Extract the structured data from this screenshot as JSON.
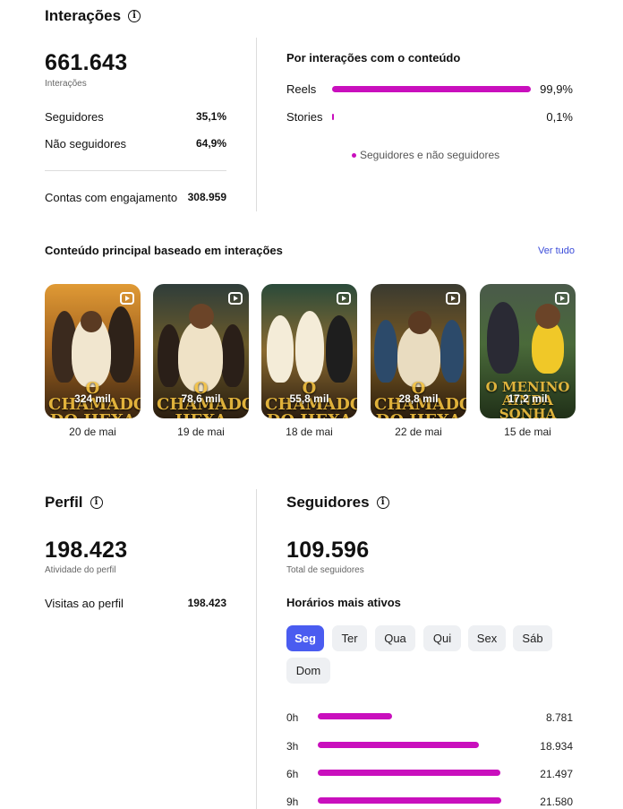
{
  "interactions": {
    "title": "Interações",
    "total": "661.643",
    "total_label": "Interações",
    "followers_label": "Seguidores",
    "followers_pct": "35,1%",
    "non_followers_label": "Não seguidores",
    "non_followers_pct": "64,9%",
    "engaged_label": "Contas com engajamento",
    "engaged_value": "308.959"
  },
  "by_content": {
    "title": "Por interações com o conteúdo",
    "rows": [
      {
        "label": "Reels",
        "value": "99,9%",
        "fraction": 0.999
      },
      {
        "label": "Stories",
        "value": "0,1%",
        "fraction": 0.001
      }
    ],
    "legend": "Seguidores e não seguidores",
    "accent": "#c90fbd"
  },
  "top_content": {
    "title": "Conteúdo principal baseado em interações",
    "see_all": "Ver tudo",
    "items": [
      {
        "count": "324 mil",
        "date": "20 de mai",
        "art": "O CHAMADO DO HEXA"
      },
      {
        "count": "78,6 mil",
        "date": "19 de mai",
        "art": "O CHAMADO HEXA"
      },
      {
        "count": "55,8 mil",
        "date": "18 de mai",
        "art": "O CHAMADO DO HEXA"
      },
      {
        "count": "28,8 mil",
        "date": "22 de mai",
        "art": "O CHAMADO DO HEXA"
      },
      {
        "count": "17,2 mil",
        "date": "15 de mai",
        "art": "O MENINO AINDA SONHA"
      }
    ]
  },
  "profile": {
    "title": "Perfil",
    "total": "198.423",
    "total_label": "Atividade do perfil",
    "visits_label": "Visitas ao perfil",
    "visits_value": "198.423"
  },
  "followers": {
    "title": "Seguidores",
    "total": "109.596",
    "total_label": "Total de seguidores",
    "active_title": "Horários mais ativos",
    "days": [
      "Seg",
      "Ter",
      "Qua",
      "Qui",
      "Sex",
      "Sáb",
      "Dom"
    ],
    "active_day": "Seg",
    "hours": [
      {
        "label": "0h",
        "value": "8.781",
        "fraction": 0.407
      },
      {
        "label": "3h",
        "value": "18.934",
        "fraction": 0.877
      },
      {
        "label": "6h",
        "value": "21.497",
        "fraction": 0.996
      },
      {
        "label": "9h",
        "value": "21.580",
        "fraction": 1.0
      }
    ]
  }
}
